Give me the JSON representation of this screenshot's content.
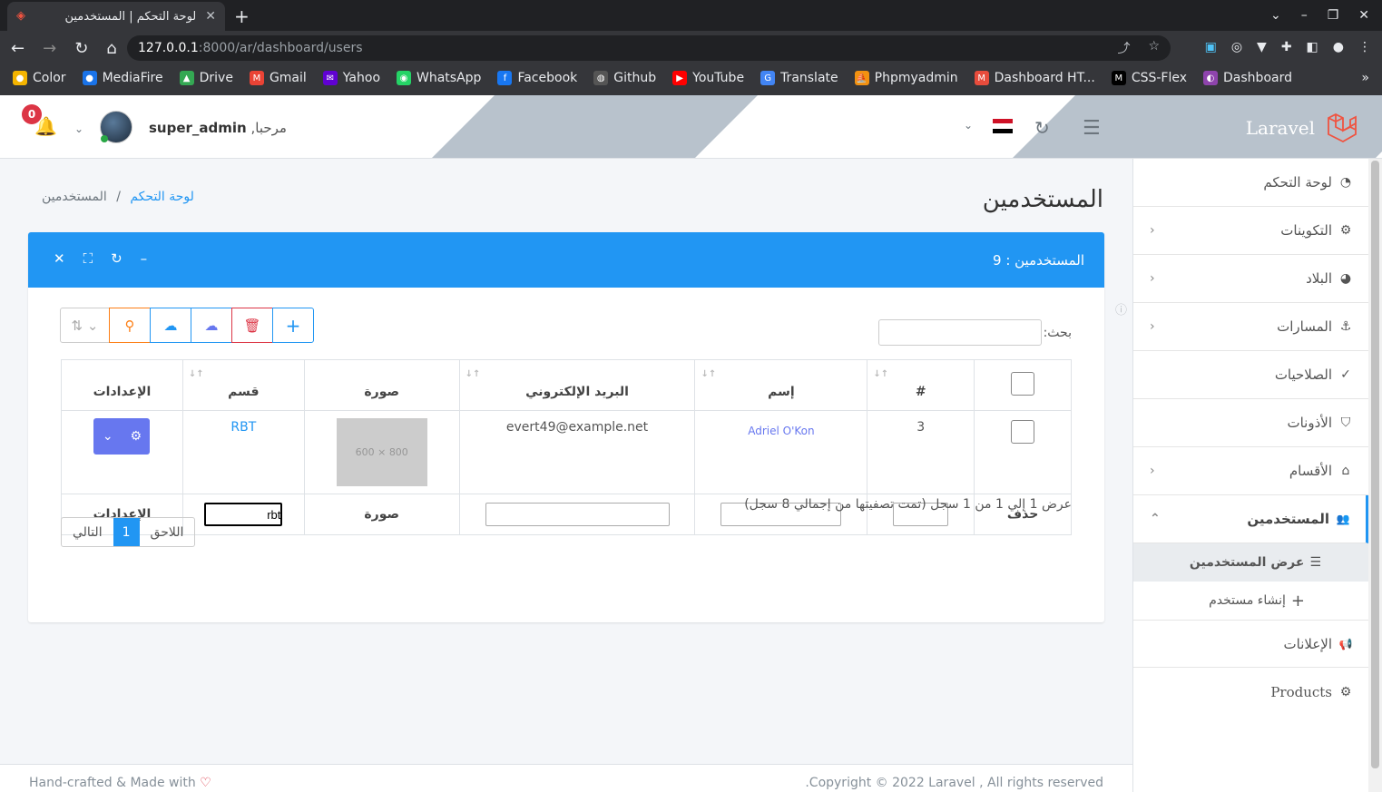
{
  "browser": {
    "tab_title": "لوحة التحكم | المستخدمين",
    "url_host": "127.0.0.1",
    "url_path": ":8000/ar/dashboard/users",
    "bookmarks": [
      {
        "label": "Color",
        "color": "#f4b400"
      },
      {
        "label": "MediaFire",
        "color": "#1a73e8"
      },
      {
        "label": "Drive",
        "color": "#34a853"
      },
      {
        "label": "Gmail",
        "color": "#ea4335"
      },
      {
        "label": "Yahoo",
        "color": "#6001d2"
      },
      {
        "label": "WhatsApp",
        "color": "#25d366"
      },
      {
        "label": "Facebook",
        "color": "#1877f2"
      },
      {
        "label": "Github",
        "color": "#555555"
      },
      {
        "label": "YouTube",
        "color": "#ff0000"
      },
      {
        "label": "Translate",
        "color": "#4285f4"
      },
      {
        "label": "Phpmyadmin",
        "color": "#f29111"
      },
      {
        "label": "Dashboard HT...",
        "color": "#e74c3c"
      },
      {
        "label": "CSS-Flex",
        "color": "#000000"
      },
      {
        "label": "Dashboard",
        "color": "#8e44ad"
      }
    ]
  },
  "header": {
    "brand": "Laravel",
    "notifications_count": "0",
    "greeting": "مرحبا,",
    "username": "super_admin"
  },
  "sidebar": {
    "items": [
      {
        "label": "لوحة التحكم",
        "icon": "dashboard-icon",
        "glyph": "◔",
        "chevron": false
      },
      {
        "label": "التكوينات",
        "icon": "cogs-icon",
        "glyph": "⚙",
        "chevron": true
      },
      {
        "label": "البلاد",
        "icon": "globe-icon",
        "glyph": "◕",
        "chevron": true
      },
      {
        "label": "المسارات",
        "icon": "anchor-icon",
        "glyph": "⚓",
        "chevron": true
      },
      {
        "label": "الصلاحيات",
        "icon": "check-icon",
        "glyph": "✓",
        "chevron": false
      },
      {
        "label": "الأذونات",
        "icon": "shield-icon",
        "glyph": "⛉",
        "chevron": false
      },
      {
        "label": "الأقسام",
        "icon": "home-icon",
        "glyph": "⌂",
        "chevron": true
      }
    ],
    "active": {
      "label": "المستخدمين",
      "icon": "users-icon",
      "glyph": "👥"
    },
    "sub": [
      {
        "label": "عرض المستخدمين",
        "glyph": "☰"
      },
      {
        "label": "إنشاء مستخدم",
        "glyph": "+"
      }
    ],
    "bottom": [
      {
        "label": "الإعلانات",
        "icon": "bullhorn-icon",
        "glyph": "📢"
      },
      {
        "label": "Products",
        "icon": "cogs-icon",
        "glyph": "⚙"
      }
    ]
  },
  "page": {
    "title": "المستخدمين",
    "breadcrumb_home": "لوحة التحكم",
    "breadcrumb_sep": "/",
    "breadcrumb_current": "المستخدمين"
  },
  "card": {
    "title": "المستخدمين : 9",
    "search_label": "بحث:",
    "columns": [
      "#",
      "إسم",
      "البريد الإلكتروني",
      "صورة",
      "قسم",
      "الإعدادات"
    ],
    "row": {
      "id": "3",
      "name": "Adriel O'Kon",
      "email": "evert49@example.net",
      "image_text": "800 × 600",
      "section": "RBT"
    },
    "filter": {
      "delete_label": "حذف",
      "image_label": "صورة",
      "settings_label": "الإعدادات",
      "section_value": "rbt"
    },
    "info": "عرض 1 إلي 1 من 1 سجل (تمت تصفيتها من إجمالي 8 سجل)",
    "pager": {
      "prev": "التالي",
      "current": "1",
      "next": "اللاحق"
    }
  },
  "footer": {
    "left": "Hand-crafted & Made with",
    "right": ".Copyright © 2022 Laravel , All rights reserved"
  },
  "colors": {
    "primary": "#2196f3",
    "danger": "#dc3545",
    "purple": "#6777ef",
    "orange": "#fd7e14"
  }
}
